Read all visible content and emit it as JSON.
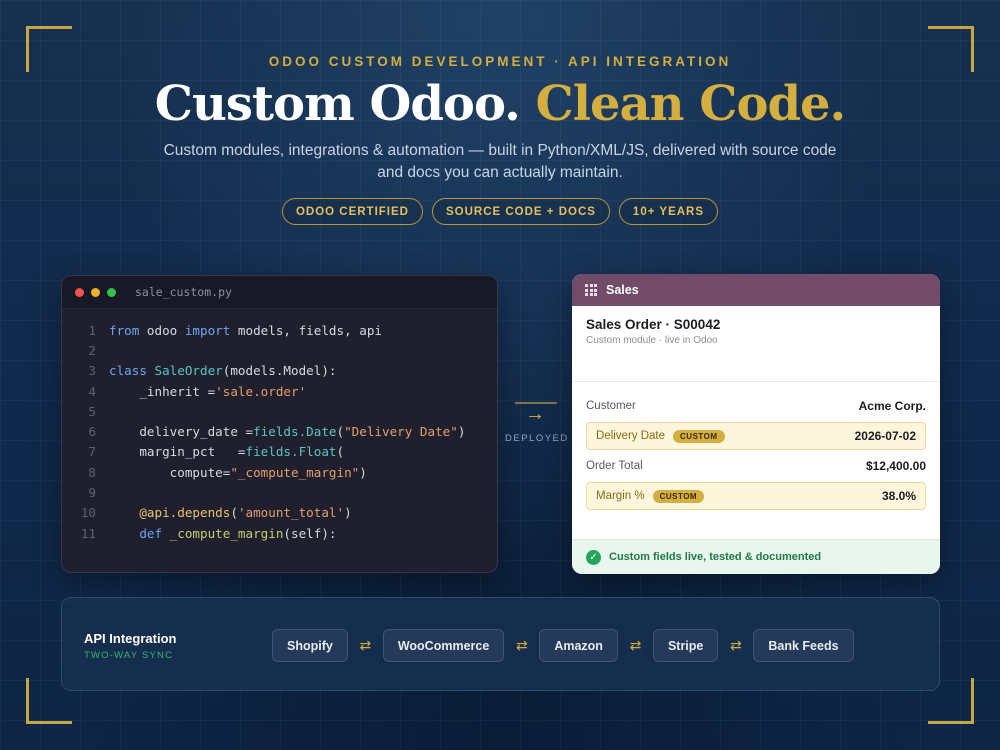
{
  "header": {
    "eyebrow": "ODOO CUSTOM DEVELOPMENT · API INTEGRATION",
    "headline_main": "Custom Odoo.",
    "headline_accent": "Clean Code.",
    "subtitle": "Custom modules, integrations & automation — built in Python/XML/JS, delivered with source code and docs you can actually maintain.",
    "pills": [
      "ODOO CERTIFIED",
      "SOURCE CODE + DOCS",
      "10+ YEARS"
    ]
  },
  "editor": {
    "filename": "sale_custom.py",
    "line_numbers": [
      "1",
      "2",
      "3",
      "4",
      "5",
      "6",
      "7",
      "8",
      "9",
      "10",
      "11"
    ],
    "tokens": {
      "from": "from",
      "odoo": " odoo ",
      "import": "import",
      "imports": " models, fields, api",
      "class": "class",
      "classname": "SaleOrder",
      "classbase": "(models.Model):",
      "inherit": "_inherit =",
      "inherit_val": "'sale.order'",
      "delivery": "delivery_date =",
      "date_fn": "fields.Date",
      "date_open": "(",
      "date_label": "\"Delivery Date\"",
      "date_close": ")",
      "margin": "margin_pct   =",
      "float_fn": "fields.Float",
      "float_open": "(",
      "compute": "compute=",
      "compute_val": "\"_compute_margin\"",
      "compute_close": ")",
      "decorator": "@api.depends",
      "dec_open": "(",
      "dec_arg": "'amount_total'",
      "dec_close": ")",
      "def": "def",
      "method": " _compute_margin",
      "method_args": "(self):"
    }
  },
  "deploy": {
    "label": "DEPLOYED",
    "arrow": "→"
  },
  "odoo_card": {
    "app": "Sales",
    "order_title": "Sales Order · S00042",
    "order_sub": "Custom module · live in Odoo",
    "rows": [
      {
        "label": "Customer",
        "value": "Acme Corp."
      },
      {
        "label": "Delivery Date",
        "badge": "CUSTOM",
        "value": "2026-07-02"
      },
      {
        "label": "Order Total",
        "value": "$12,400.00"
      },
      {
        "label": "Margin %",
        "badge": "CUSTOM",
        "value": "38.0%"
      }
    ],
    "footer": "Custom fields live, tested & documented"
  },
  "api": {
    "title": "API Integration",
    "subtitle": "TWO-WAY SYNC",
    "integrations": [
      "Shopify",
      "WooCommerce",
      "Amazon",
      "Stripe",
      "Bank Feeds"
    ],
    "separator": "⇄"
  },
  "colors": {
    "gold": "#d4ae3e",
    "navy": "#0f2747",
    "odoo_purple": "#714b67",
    "success": "#23a55a"
  }
}
